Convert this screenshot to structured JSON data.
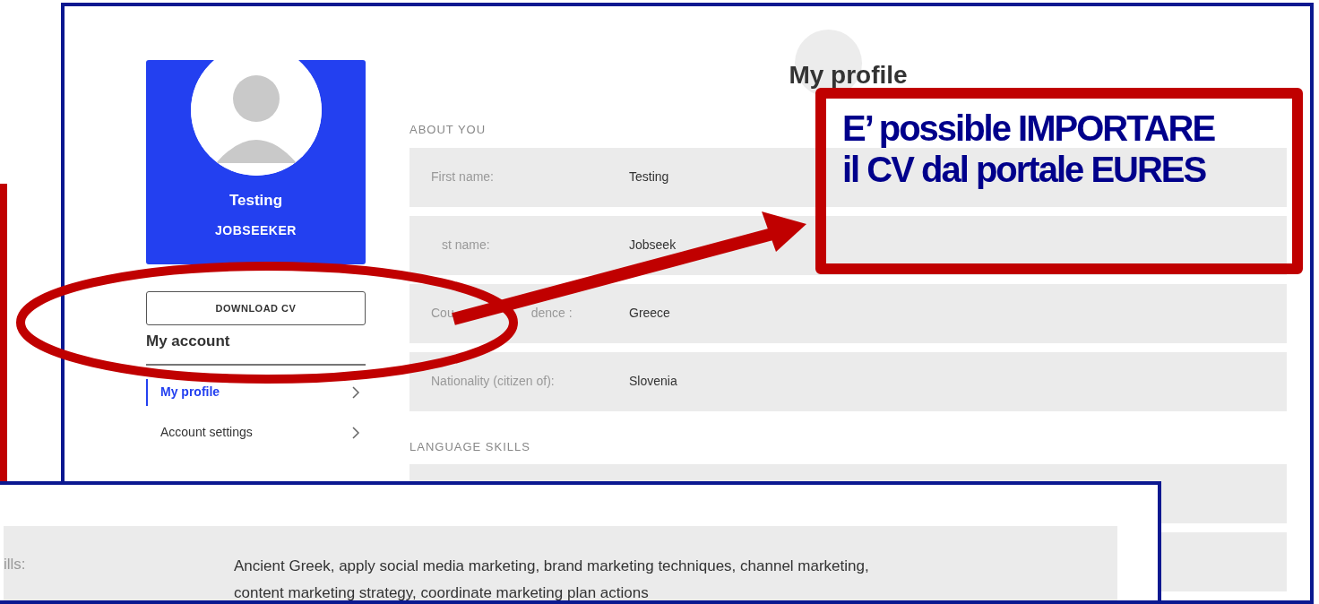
{
  "profile_card": {
    "name": "Testing",
    "role": "JOBSEEKER"
  },
  "download_button": "DOWNLOAD CV",
  "account_menu": {
    "title": "My account",
    "items": [
      {
        "label": "My profile",
        "selected": true
      },
      {
        "label": "Account settings",
        "selected": false
      }
    ]
  },
  "page_title": "My profile",
  "about_section": {
    "heading": "ABOUT YOU",
    "rows": [
      {
        "label": "First name:",
        "value": "Testing"
      },
      {
        "label": "st name:",
        "value": "Jobseek"
      },
      {
        "label": "Cou",
        "label_end": "dence :",
        "value": "Greece"
      },
      {
        "label": "Nationality (citizen of):",
        "value": "Slovenia"
      }
    ]
  },
  "language_section": {
    "heading": "LANGUAGE SKILLS"
  },
  "callout": {
    "lines": [
      "E’ possible IMPORTARE",
      "il CV dal portale EURES"
    ]
  },
  "second_screenshot": {
    "label": "ills:",
    "value_lines": [
      "Ancient Greek, apply social media marketing, brand marketing techniques, channel marketing,",
      "content marketing strategy, coordinate marketing plan actions"
    ]
  }
}
